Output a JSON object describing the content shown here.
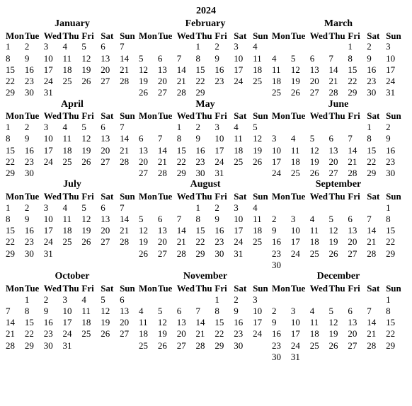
{
  "year": "2024",
  "day_headers": [
    "Mon",
    "Tue",
    "Wed",
    "Thu",
    "Fri",
    "Sat",
    "Sun"
  ],
  "months": [
    {
      "name": "January",
      "first_weekday": 0,
      "days": 31
    },
    {
      "name": "February",
      "first_weekday": 3,
      "days": 29
    },
    {
      "name": "March",
      "first_weekday": 4,
      "days": 31
    },
    {
      "name": "April",
      "first_weekday": 0,
      "days": 30
    },
    {
      "name": "May",
      "first_weekday": 2,
      "days": 31
    },
    {
      "name": "June",
      "first_weekday": 5,
      "days": 30
    },
    {
      "name": "July",
      "first_weekday": 0,
      "days": 31
    },
    {
      "name": "August",
      "first_weekday": 3,
      "days": 31
    },
    {
      "name": "September",
      "first_weekday": 6,
      "days": 30
    },
    {
      "name": "October",
      "first_weekday": 1,
      "days": 31
    },
    {
      "name": "November",
      "first_weekday": 4,
      "days": 30
    },
    {
      "name": "December",
      "first_weekday": 6,
      "days": 31
    }
  ]
}
